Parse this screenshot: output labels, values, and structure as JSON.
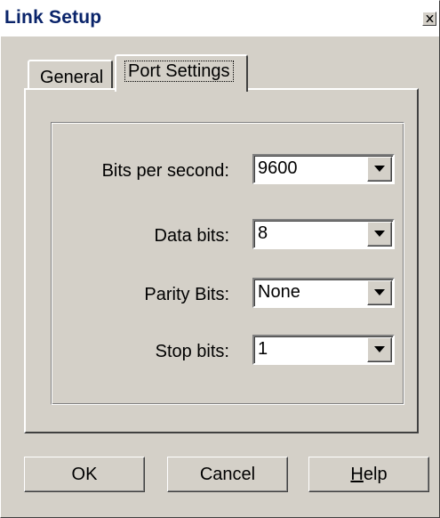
{
  "window": {
    "title": "Link Setup",
    "close_icon": "close-icon"
  },
  "tabs": [
    {
      "label": "General",
      "active": false
    },
    {
      "label": "Port Settings",
      "active": true
    }
  ],
  "port_settings": {
    "fields": [
      {
        "label": "Bits per second:",
        "value": "9600"
      },
      {
        "label": "Data bits:",
        "value": "8"
      },
      {
        "label": "Parity Bits:",
        "value": "None"
      },
      {
        "label": "Stop bits:",
        "value": "1"
      }
    ]
  },
  "buttons": {
    "ok": "OK",
    "cancel": "Cancel",
    "help_mnemonic": "H",
    "help_rest": "elp"
  },
  "colors": {
    "face": "#d4d0c8",
    "title_text": "#0a246a"
  }
}
